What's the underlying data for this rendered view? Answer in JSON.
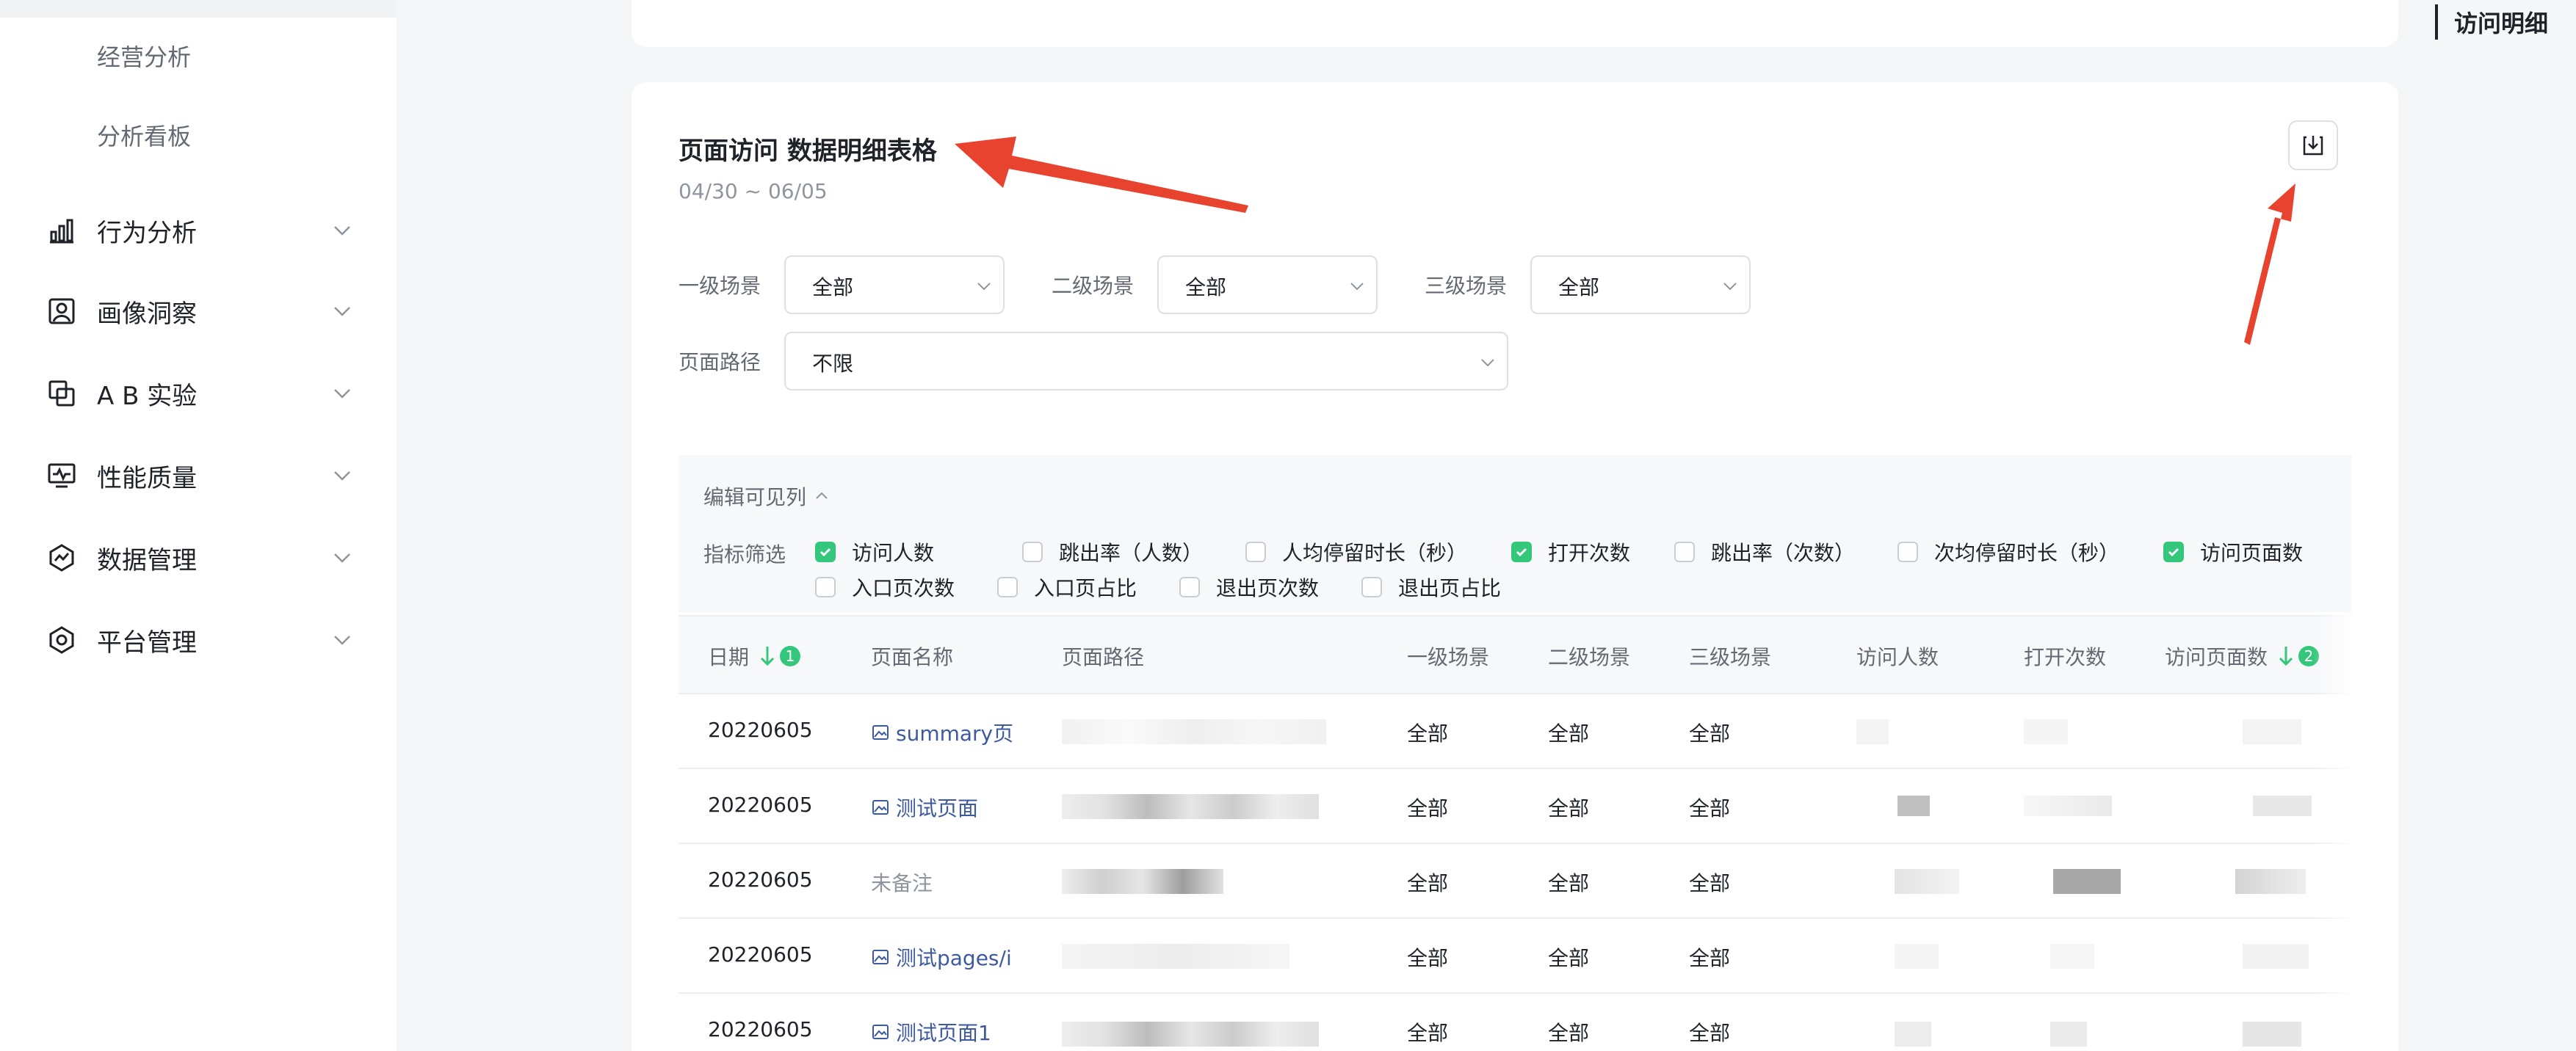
{
  "sidebar": {
    "sub_items": [
      "经营分析",
      "分析看板"
    ],
    "menus": [
      {
        "label": "行为分析",
        "icon": "bar-chart-icon"
      },
      {
        "label": "画像洞察",
        "icon": "portrait-icon"
      },
      {
        "label": "A B 实验",
        "icon": "ab-test-icon"
      },
      {
        "label": "性能质量",
        "icon": "monitor-icon"
      },
      {
        "label": "数据管理",
        "icon": "data-manage-icon"
      },
      {
        "label": "平台管理",
        "icon": "platform-icon"
      }
    ]
  },
  "right_nav": {
    "label": "访问明细"
  },
  "panel": {
    "title": "页面访问 数据明细表格",
    "date_range": "04/30 ~ 06/05"
  },
  "filters": {
    "level1": {
      "label": "一级场景",
      "value": "全部"
    },
    "level2": {
      "label": "二级场景",
      "value": "全部"
    },
    "level3": {
      "label": "三级场景",
      "value": "全部"
    },
    "path": {
      "label": "页面路径",
      "value": "不限"
    }
  },
  "columns_panel": {
    "edit_label": "编辑可见列",
    "indicator_label": "指标筛选",
    "metrics": [
      {
        "label": "访问人数",
        "checked": true
      },
      {
        "label": "跳出率（人数）",
        "checked": false
      },
      {
        "label": "人均停留时长（秒）",
        "checked": false
      },
      {
        "label": "打开次数",
        "checked": true
      },
      {
        "label": "跳出率（次数）",
        "checked": false
      },
      {
        "label": "次均停留时长（秒）",
        "checked": false
      },
      {
        "label": "访问页面数",
        "checked": true
      },
      {
        "label": "入口页次数",
        "checked": false
      },
      {
        "label": "入口页占比",
        "checked": false
      },
      {
        "label": "退出页次数",
        "checked": false
      },
      {
        "label": "退出页占比",
        "checked": false
      }
    ]
  },
  "table": {
    "headers": [
      "日期",
      "页面名称",
      "页面路径",
      "一级场景",
      "二级场景",
      "三级场景",
      "访问人数",
      "打开次数",
      "访问页面数"
    ],
    "sort_badges": {
      "date": "1",
      "page_views": "2"
    },
    "rows": [
      {
        "date": "20220605",
        "name": "summary页",
        "name_type": "link",
        "s1": "全部",
        "s2": "全部",
        "s3": "全部"
      },
      {
        "date": "20220605",
        "name": "测试页面",
        "name_type": "link",
        "s1": "全部",
        "s2": "全部",
        "s3": "全部"
      },
      {
        "date": "20220605",
        "name": "未备注",
        "name_type": "muted",
        "s1": "全部",
        "s2": "全部",
        "s3": "全部"
      },
      {
        "date": "20220605",
        "name": "测试pages/i",
        "name_type": "link",
        "s1": "全部",
        "s2": "全部",
        "s3": "全部"
      },
      {
        "date": "20220605",
        "name": "测试页面1",
        "name_type": "link",
        "s1": "全部",
        "s2": "全部",
        "s3": "全部"
      }
    ]
  },
  "colors": {
    "accent_green": "#34c77b",
    "arrow_red": "#e8432f",
    "link_blue": "#3d5a9e"
  }
}
